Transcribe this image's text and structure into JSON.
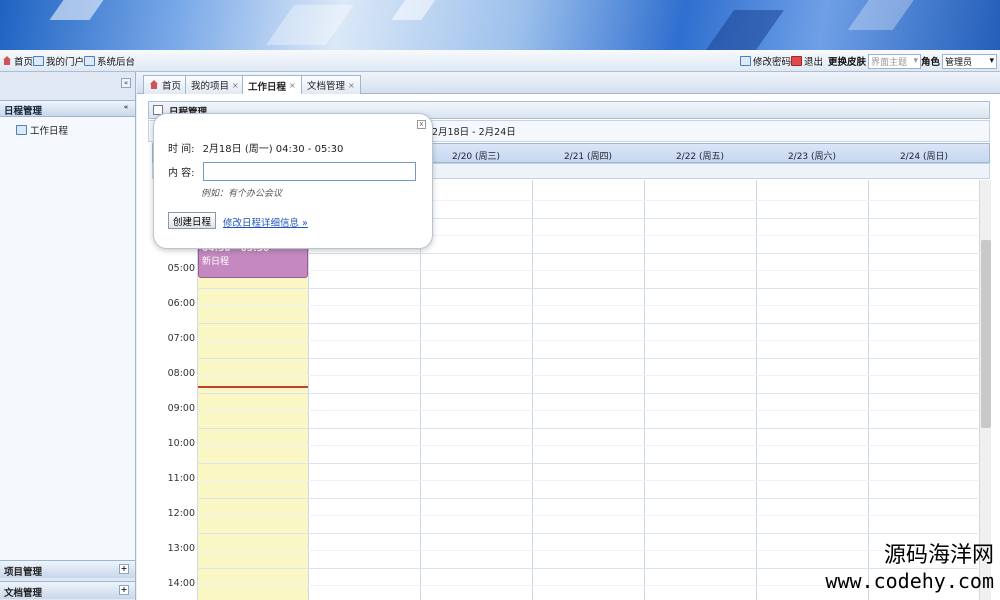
{
  "topbar": {
    "home": "首页",
    "portal": "我的门户",
    "backend": "系统后台",
    "change_password": "修改密码",
    "logout": "退出",
    "skin_label": "更换皮肤",
    "skin_value": "界面主题",
    "role_label": "角色",
    "role_value": "管理员"
  },
  "sidebar": {
    "collapse": "«",
    "section_title": "日程管理",
    "section_collapse": "«",
    "tree_item": "工作日程",
    "bottom": [
      {
        "label": "项目管理",
        "icon": "+"
      },
      {
        "label": "文档管理",
        "icon": "+"
      }
    ]
  },
  "tabs": [
    {
      "label": "首页",
      "closable": false
    },
    {
      "label": "我的项目",
      "closable": true
    },
    {
      "label": "工作日程",
      "closable": true,
      "active": true
    },
    {
      "label": "文档管理",
      "closable": true
    }
  ],
  "calendar": {
    "title": "日程管理",
    "range": "2月18日 - 2月24日",
    "days": [
      "2/20 (周三)",
      "2/21 (周四)",
      "2/22 (周五)",
      "2/23 (周六)",
      "2/24 (周日)"
    ],
    "times": [
      "05:00",
      "06:00",
      "07:00",
      "08:00",
      "09:00",
      "10:00",
      "11:00",
      "12:00",
      "13:00",
      "14:00"
    ],
    "event": {
      "time": "04:30 - 05:30",
      "title": "新日程",
      "color": "#c48ac0"
    },
    "today_color": "#fbf7c4"
  },
  "popup": {
    "close": "x",
    "time_label": "时 间:",
    "time_value": "2月18日 (周一) 04:30 - 05:30",
    "content_label": "内 容:",
    "content_value": "",
    "hint": "例如：有个办公会议",
    "create_button": "创建日程",
    "edit_link": "修改日程详细信息 »"
  },
  "watermark": {
    "line1": "源码海洋网",
    "line2": "www.codehy.com"
  }
}
